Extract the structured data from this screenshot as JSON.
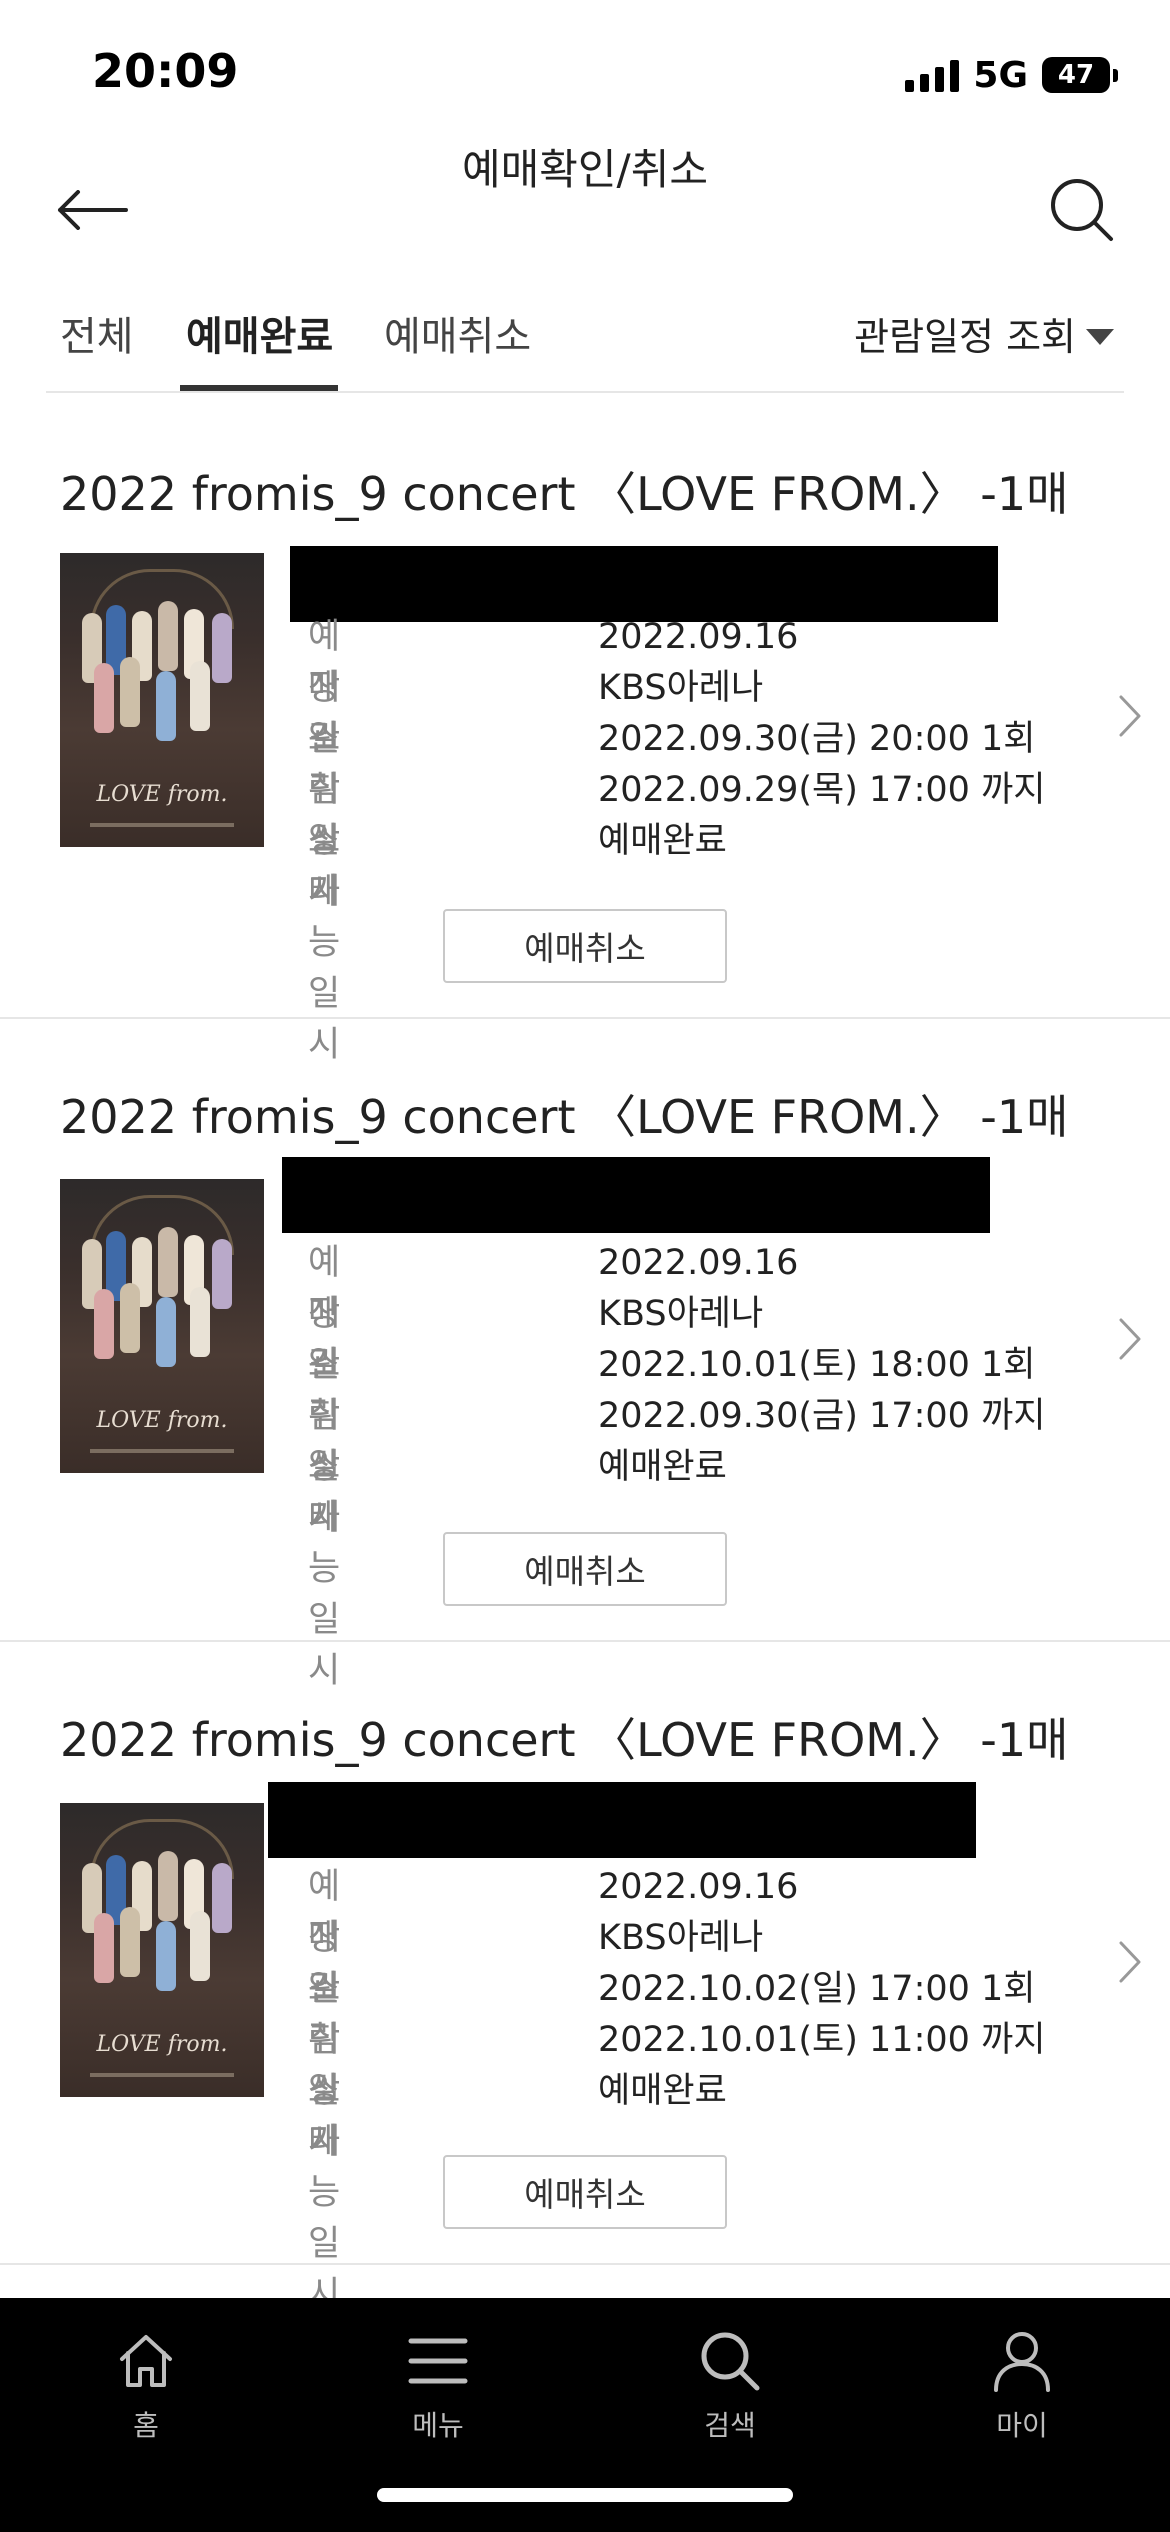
{
  "status_bar": {
    "time": "20:09",
    "network": "5G",
    "battery": "47"
  },
  "header": {
    "title": "예매확인/취소",
    "back_icon": "arrow-left-icon",
    "search_icon": "search-icon"
  },
  "tabs": [
    {
      "label": "전체",
      "active": false
    },
    {
      "label": "예매완료",
      "active": true
    },
    {
      "label": "예매취소",
      "active": false
    }
  ],
  "filter": {
    "label": "관람일정 조회"
  },
  "bookings": [
    {
      "title": "2022 fromis_9 concert 〈LOVE FROM.〉 -1매",
      "poster_text": "LOVE from.",
      "rows": [
        {
          "label": "예매일",
          "value": "2022.09.16"
        },
        {
          "label": "장소",
          "value": "KBS아레나"
        },
        {
          "label": "관람일시",
          "value": "2022.09.30(금) 20:00 1회"
        },
        {
          "label": "취소가능일시",
          "value": "2022.09.29(목) 17:00 까지"
        },
        {
          "label": "상태",
          "value": "예매완료"
        }
      ],
      "cancel_label": "예매취소"
    },
    {
      "title": "2022 fromis_9 concert 〈LOVE FROM.〉 -1매",
      "poster_text": "LOVE from.",
      "rows": [
        {
          "label": "예매일",
          "value": "2022.09.16"
        },
        {
          "label": "장소",
          "value": "KBS아레나"
        },
        {
          "label": "관람일시",
          "value": "2022.10.01(토) 18:00 1회"
        },
        {
          "label": "취소가능일시",
          "value": "2022.09.30(금) 17:00 까지"
        },
        {
          "label": "상태",
          "value": "예매완료"
        }
      ],
      "cancel_label": "예매취소"
    },
    {
      "title": "2022 fromis_9 concert 〈LOVE FROM.〉 -1매",
      "poster_text": "LOVE from.",
      "rows": [
        {
          "label": "예매일",
          "value": "2022.09.16"
        },
        {
          "label": "장소",
          "value": "KBS아레나"
        },
        {
          "label": "관람일시",
          "value": "2022.10.02(일) 17:00 1회"
        },
        {
          "label": "취소가능일시",
          "value": "2022.10.01(토) 11:00 까지"
        },
        {
          "label": "상태",
          "value": "예매완료"
        }
      ],
      "cancel_label": "예매취소"
    }
  ],
  "bottom_nav": [
    {
      "label": "홈",
      "icon": "home-icon"
    },
    {
      "label": "메뉴",
      "icon": "menu-icon"
    },
    {
      "label": "검색",
      "icon": "search-icon"
    },
    {
      "label": "마이",
      "icon": "person-icon"
    }
  ]
}
